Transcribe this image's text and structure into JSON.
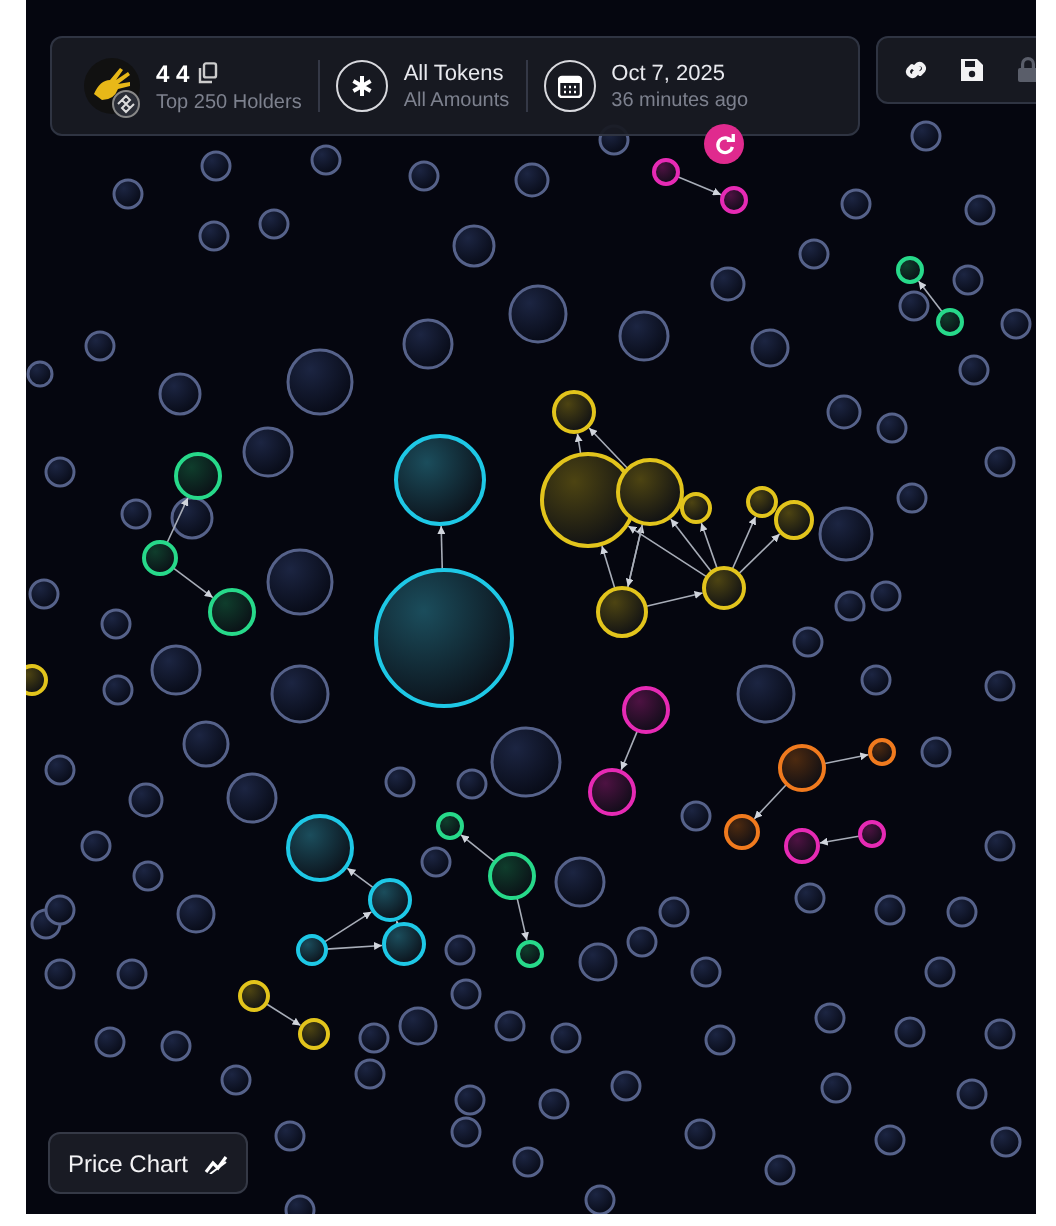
{
  "header": {
    "name": "4 4",
    "subtitle": "Top 250 Holders",
    "token_filter": {
      "title": "All Tokens",
      "subtitle": "All Amounts"
    },
    "date": {
      "title": "Oct 7, 2025",
      "subtitle": "36 minutes ago"
    }
  },
  "toolbar": [
    {
      "kind": "link",
      "disabled": false
    },
    {
      "kind": "save",
      "disabled": false
    },
    {
      "kind": "lock",
      "disabled": true
    }
  ],
  "price_chart_button": {
    "label": "Price Chart"
  }
}
